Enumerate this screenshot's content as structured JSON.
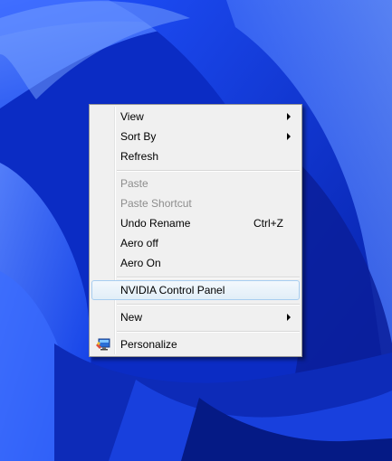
{
  "menu": {
    "items": [
      {
        "label": "View",
        "submenu": true
      },
      {
        "label": "Sort By",
        "submenu": true
      },
      {
        "label": "Refresh"
      },
      {
        "label": "Paste",
        "disabled": true
      },
      {
        "label": "Paste Shortcut",
        "disabled": true
      },
      {
        "label": "Undo Rename",
        "shortcut": "Ctrl+Z"
      },
      {
        "label": "Aero off"
      },
      {
        "label": "Aero On"
      },
      {
        "label": "NVIDIA Control Panel",
        "highlighted": true
      },
      {
        "label": "New",
        "submenu": true
      },
      {
        "label": "Personalize",
        "icon": "personalize-icon"
      }
    ]
  },
  "colors": {
    "wallpaper_base": "#0a2fd0",
    "menu_bg": "#f0f0f0",
    "highlight_border": "#a7cdf0"
  }
}
